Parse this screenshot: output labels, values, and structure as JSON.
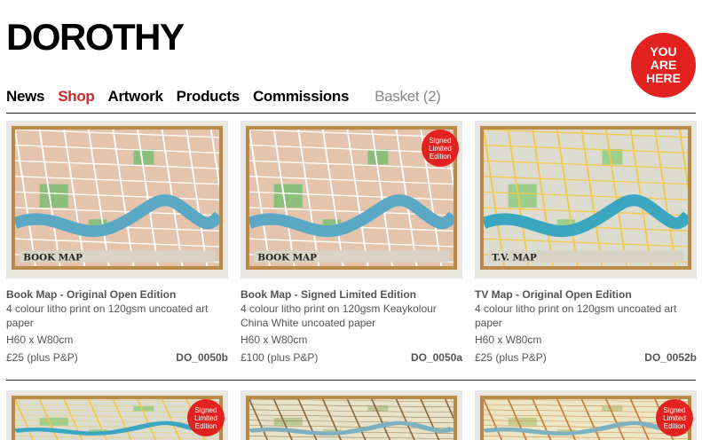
{
  "site": {
    "logo": "DOROTHY",
    "badge_lines": [
      "YOU",
      "ARE",
      "HERE"
    ]
  },
  "nav": {
    "items": [
      {
        "label": "News",
        "active": false
      },
      {
        "label": "Shop",
        "active": true
      },
      {
        "label": "Artwork",
        "active": false
      },
      {
        "label": "Products",
        "active": false
      },
      {
        "label": "Commissions",
        "active": false
      }
    ],
    "basket": "Basket (2)"
  },
  "products": [
    {
      "title": "Book Map - Original Open Edition",
      "desc": "4 colour litho print on 120gsm uncoated art paper",
      "size": "H60 x W80cm",
      "price": "£25 (plus P&P)",
      "code": "DO_0050b",
      "signed": false,
      "map_label": "BOOK MAP",
      "colors": {
        "land": "#e4c4ad",
        "park": "#8cbf7c",
        "water": "#5aa8c4",
        "roads": "#ffffff"
      }
    },
    {
      "title": "Book Map - Signed Limited Edition",
      "desc": "4 colour litho print on 120gsm Keaykolour China White uncoated paper",
      "size": "H60 x W80cm",
      "price": "£100 (plus P&P)",
      "code": "DO_0050a",
      "signed": true,
      "map_label": "BOOK MAP",
      "colors": {
        "land": "#e4c4ad",
        "park": "#8cbf7c",
        "water": "#5aa8c4",
        "roads": "#ffffff"
      }
    },
    {
      "title": "TV Map - Original Open Edition",
      "desc": "4 colour litho print on 120gsm uncoated art paper",
      "size": "H60 x W80cm",
      "price": "£25 (plus P&P)",
      "code": "DO_0052b",
      "signed": false,
      "map_label": "T.V. MAP",
      "colors": {
        "land": "#dcdcd0",
        "park": "#9ccf8c",
        "water": "#3aa6c0",
        "roads": "#f2c84b"
      }
    }
  ],
  "bottom_row": [
    {
      "signed": true,
      "colors": {
        "land": "#dcdcd0",
        "park": "#9ccf8c",
        "water": "#3aa6c0",
        "roads": "#f2c84b"
      }
    },
    {
      "signed": false,
      "colors": {
        "land": "#e8e3c8",
        "park": "#b8c890",
        "water": "#7fb0c0",
        "roads": "#8a6a40"
      }
    },
    {
      "signed": true,
      "colors": {
        "land": "#ece6c4",
        "park": "#c4cc90",
        "water": "#7fb0c0",
        "roads": "#c87a3a"
      }
    }
  ],
  "signed_badge": [
    "Signed",
    "Limited",
    "Edition"
  ]
}
